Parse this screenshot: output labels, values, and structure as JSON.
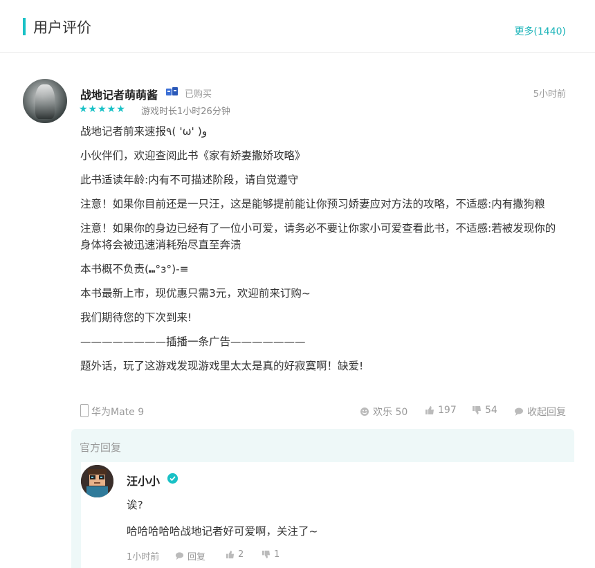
{
  "header": {
    "title": "用户评价",
    "more_label": "更多(1440)"
  },
  "review": {
    "username": "战地记者萌萌酱",
    "bought_label": "已购买",
    "time_ago": "5小时前",
    "rating_stars": 5,
    "stars_display": "★★★★★",
    "playtime": "游戏时长1小时26分钟",
    "lines": [
      "战地记者前来速报٩( 'ω' )و",
      "小伙伴们，欢迎查阅此书《家有娇妻撒娇攻略》",
      "此书适读年龄:内有不可描述阶段，请自觉遵守",
      "注意！如果你目前还是一只汪，这是能够提前能让你预习娇妻应对方法的攻略，不适感:内有撒狗粮",
      "注意！如果你的身边已经有了一位小可爱，请务必不要让你家小可爱查看此书，不适感:若被发现你的身体将会被迅速消耗殆尽直至奔溃",
      "本书概不负责(⑉°з°)-≡",
      "本书最新上市，现优惠只需3元，欢迎前来订购~",
      "我们期待您的下次到来!",
      "————————插播一条广告———————",
      "题外话，玩了这游戏发现游戏里太太是真的好寂寞啊！缺爱!"
    ],
    "device": "华为Mate 9",
    "funny_label": "欢乐 50",
    "likes": "197",
    "dislikes": "54",
    "collapse_label": "收起回复"
  },
  "official_reply": {
    "section_title": "官方回复",
    "dev_name": "汪小小",
    "lines": [
      "诶?",
      "哈哈哈哈哈战地记者好可爱啊，关注了~"
    ],
    "time_ago": "1小时前",
    "reply_label": "回复",
    "likes": "2",
    "dislikes": "1"
  },
  "colors": {
    "accent": "#19c1c6",
    "reply_bg": "#eef8f8"
  }
}
